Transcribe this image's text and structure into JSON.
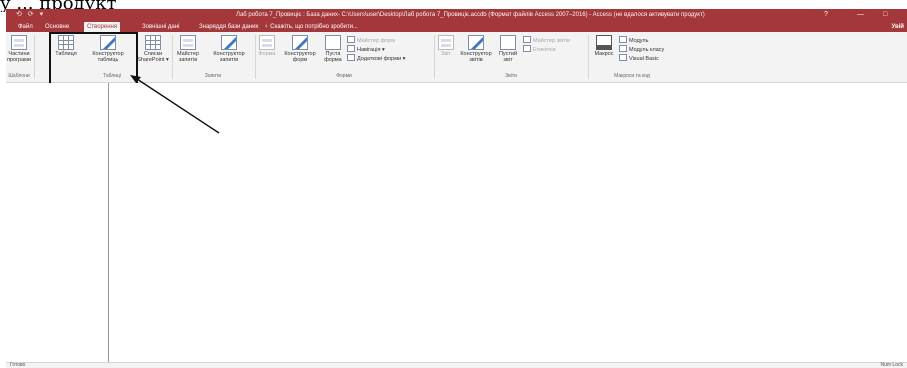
{
  "caption": "у ... продукт",
  "window": {
    "qa_icons": " ⟲ ⟳ ▾",
    "title": "Лаб робота 7_Провиціє : База даних- C:\\Users\\user\\Desktop\\Лаб робота 7_Провиціє.accdb (Формат файлів Access 2007–2016) - Access (не вдалося активувати продукт)",
    "help": "?",
    "minimize": "—",
    "restore": "□"
  },
  "tabs": [
    "Файл",
    "Основне",
    "Створення",
    "Зовнішні дані",
    "Знаряддя бази даних",
    "♀ Скажіть, що потрібно зробити..."
  ],
  "active_tab": "Створення",
  "user_tab": "Увій",
  "ribbon": {
    "templates": {
      "parts_label": "Частини програми",
      "group": "Шаблони"
    },
    "tables": {
      "table_label": "Таблиця",
      "designer_label": "Конструктор таблиць",
      "sharepoint_label": "Списки SharePoint ▾",
      "group": "Таблиці"
    },
    "queries": {
      "wizard_label": "Майстер запитів",
      "designer_label": "Конструктор запитів",
      "group": "Запити"
    },
    "forms": {
      "form_label": "Форма",
      "designer_label": "Конструктор форм",
      "blank_label": "Пуста форма",
      "wizard_small": "Майстер форм",
      "nav_small": "Навігація ▾",
      "more_small": "Додаткові форми ▾",
      "group": "Форми"
    },
    "reports": {
      "report_label": "Звіт",
      "designer_label": "Конструктор звітів",
      "blank_label": "Пустий звіт",
      "wizard_small": "Майстер звітів",
      "labels_small": "Етикетки",
      "group": "Звіти"
    },
    "macros": {
      "macro_label": "Макрос",
      "module_small": "Модуль",
      "class_small": "Модуль класу",
      "vb_small": "Visual Basic",
      "group": "Макроси та код"
    }
  },
  "status": {
    "left": "Готово",
    "right": "Num Lock"
  }
}
